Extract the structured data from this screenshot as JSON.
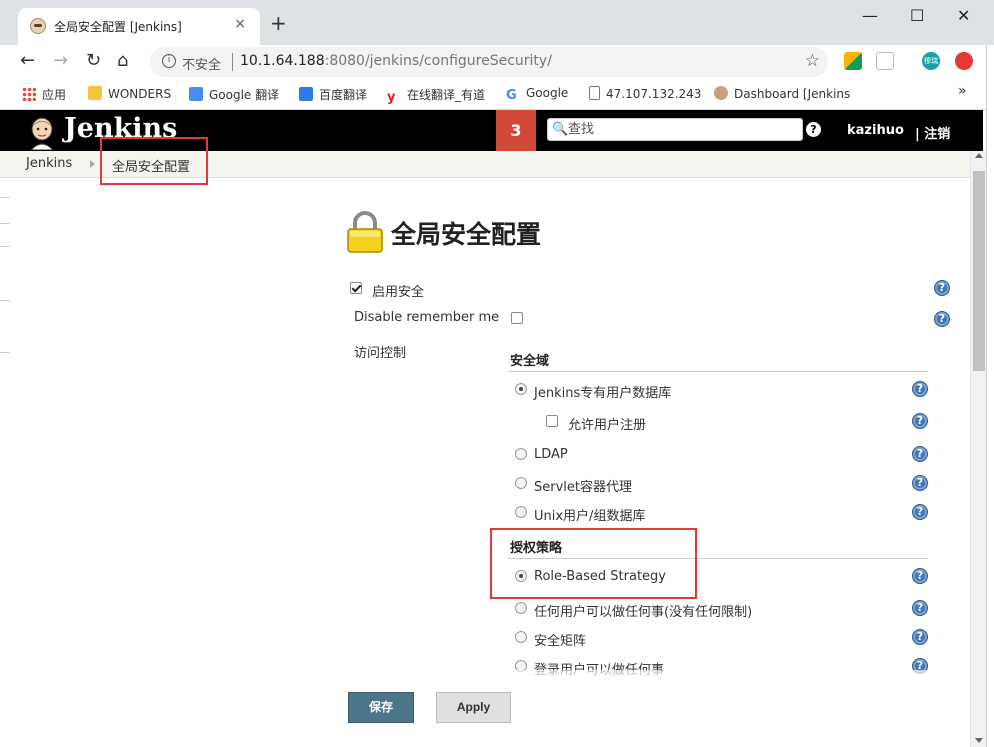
{
  "browser": {
    "tab_title": "全局安全配置 [Jenkins]",
    "tab_close": "×",
    "new_tab": "+",
    "win_min": "—",
    "win_max": "☐",
    "win_close": "✕",
    "back": "←",
    "forward": "→",
    "reload": "↻",
    "home": "⌂",
    "info_icon": "i",
    "insecure_label": "不安全",
    "url_host": "10.1.64.188",
    "url_rest": ":8080/jenkins/configureSecurity/",
    "star": "☆",
    "ext_label": "穆瑞",
    "bookmarks_more": "»",
    "bookmarks": [
      {
        "label": "应用",
        "color": "#e8453c"
      },
      {
        "label": "WONDERS",
        "color": "#f5c542"
      },
      {
        "label": "Google 翻译",
        "color": "#4a8af4"
      },
      {
        "label": "百度翻译",
        "color": "#2c7be5"
      },
      {
        "label": "在线翻译_有道",
        "color": "#e02020"
      },
      {
        "label": "Google",
        "color": "#34a853"
      },
      {
        "label": "47.107.132.243",
        "color": "#ffffff"
      },
      {
        "label": "Dashboard [Jenkins",
        "color": "#c8a07a"
      }
    ]
  },
  "header": {
    "logo_text": "Jenkins",
    "notification_count": "3",
    "search_placeholder": "查找",
    "search_icon": "🔍",
    "help": "?",
    "username": "kazihuo",
    "logout": "| 注销"
  },
  "breadcrumb": {
    "root": "Jenkins",
    "current": "全局安全配置"
  },
  "page": {
    "title": "全局安全配置",
    "enable_security_label": "启用安全",
    "enable_security_checked": true,
    "disable_remember_me_label": "Disable remember me",
    "disable_remember_me_checked": false,
    "access_control_label": "访问控制",
    "security_realm": {
      "header": "安全域",
      "options": [
        {
          "label": "Jenkins专有用户数据库",
          "checked": true
        },
        {
          "label": "允许用户注册",
          "checkbox": true,
          "checked": false
        },
        {
          "label": "LDAP",
          "checked": false
        },
        {
          "label": "Servlet容器代理",
          "checked": false
        },
        {
          "label": "Unix用户/组数据库",
          "checked": false
        }
      ]
    },
    "authorization": {
      "header": "授权策略",
      "options": [
        {
          "label": "Role-Based Strategy",
          "checked": true
        },
        {
          "label": "任何用户可以做任何事(没有任何限制)",
          "checked": false
        },
        {
          "label": "安全矩阵",
          "checked": false
        },
        {
          "label": "登录用户可以做任何事",
          "checked": false
        }
      ]
    },
    "save_label": "保存",
    "apply_label": "Apply",
    "help_glyph": "?"
  },
  "colors": {
    "header_bg": "#000000",
    "badge": "#d24939",
    "save_button": "#4b758b",
    "highlight": "#e03a3a",
    "help_icon": "#4475b1"
  }
}
